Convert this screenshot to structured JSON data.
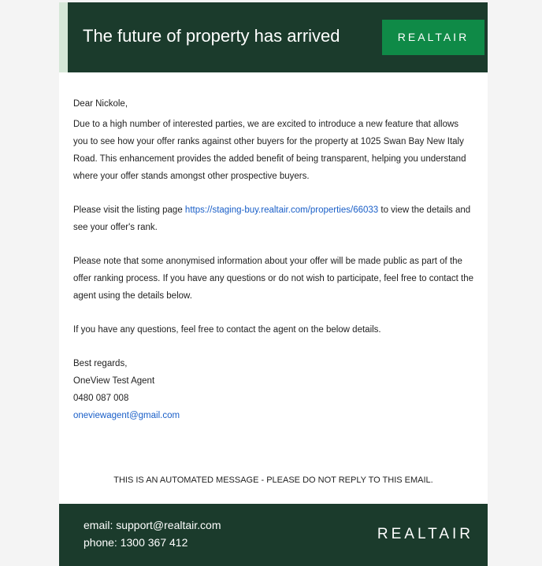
{
  "header": {
    "title": "The future of property has arrived",
    "logo": "REALTAIR"
  },
  "body": {
    "greeting": "Dear Nickole,",
    "para1": "Due to a high number of interested parties, we are excited to introduce a new feature that allows you to see how your offer ranks against other buyers for the property at 1025 Swan Bay New Italy Road. This enhancement provides the added benefit of being transparent, helping you understand where your offer stands amongst other prospective buyers.",
    "para2_before": "Please visit the listing page ",
    "para2_link": "https://staging-buy.realtair.com/properties/66033",
    "para2_after": " to view the details and see your offer's rank.",
    "para3": "Please note that some anonymised information about your offer will be made public as part of the offer ranking process. If you have any questions or do not wish to participate, feel free to contact the agent using the details below.",
    "para4": "If you have any questions, feel free to contact the agent on the below details.",
    "signoff": "Best regards,",
    "agent_name": "OneView Test Agent",
    "agent_phone": "0480 087 008",
    "agent_email": "oneviewagent@gmail.com"
  },
  "notice": "THIS IS AN AUTOMATED MESSAGE - PLEASE DO NOT REPLY TO THIS EMAIL.",
  "footer": {
    "email_line": "email: support@realtair.com",
    "phone_line": "phone: 1300 367 412",
    "logo": "REALTAIR"
  },
  "colors": {
    "brand_dark": "#1b3b2c",
    "brand_green": "#0f8a47",
    "accent": "#d5e7d7",
    "link": "#1a5fc8"
  }
}
